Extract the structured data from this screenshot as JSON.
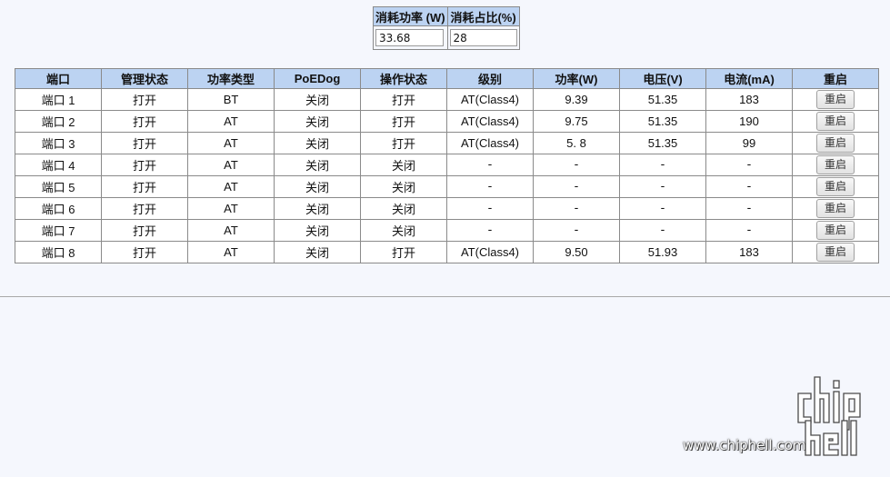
{
  "summary": {
    "headers": [
      "消耗功率 (W)",
      "消耗占比(%)"
    ],
    "values": [
      "33.68",
      "28"
    ]
  },
  "ports": {
    "headers": [
      "端口",
      "管理状态",
      "功率类型",
      "PoEDog",
      "操作状态",
      "级别",
      "功率(W)",
      "电压(V)",
      "电流(mA)",
      "重启"
    ],
    "rows": [
      {
        "port": "端口 1",
        "admin": "打开",
        "type": "BT",
        "poedog": "关闭",
        "oper": "打开",
        "class": "AT(Class4)",
        "power": "9.39",
        "voltage": "51.35",
        "current": "183",
        "restart": "重启"
      },
      {
        "port": "端口 2",
        "admin": "打开",
        "type": "AT",
        "poedog": "关闭",
        "oper": "打开",
        "class": "AT(Class4)",
        "power": "9.75",
        "voltage": "51.35",
        "current": "190",
        "restart": "重启"
      },
      {
        "port": "端口 3",
        "admin": "打开",
        "type": "AT",
        "poedog": "关闭",
        "oper": "打开",
        "class": "AT(Class4)",
        "power": "5. 8",
        "voltage": "51.35",
        "current": "99",
        "restart": "重启"
      },
      {
        "port": "端口 4",
        "admin": "打开",
        "type": "AT",
        "poedog": "关闭",
        "oper": "关闭",
        "class": "-",
        "power": "-",
        "voltage": "-",
        "current": "-",
        "restart": "重启"
      },
      {
        "port": "端口 5",
        "admin": "打开",
        "type": "AT",
        "poedog": "关闭",
        "oper": "关闭",
        "class": "-",
        "power": "-",
        "voltage": "-",
        "current": "-",
        "restart": "重启"
      },
      {
        "port": "端口 6",
        "admin": "打开",
        "type": "AT",
        "poedog": "关闭",
        "oper": "关闭",
        "class": "-",
        "power": "-",
        "voltage": "-",
        "current": "-",
        "restart": "重启"
      },
      {
        "port": "端口 7",
        "admin": "打开",
        "type": "AT",
        "poedog": "关闭",
        "oper": "关闭",
        "class": "-",
        "power": "-",
        "voltage": "-",
        "current": "-",
        "restart": "重启"
      },
      {
        "port": "端口 8",
        "admin": "打开",
        "type": "AT",
        "poedog": "关闭",
        "oper": "打开",
        "class": "AT(Class4)",
        "power": "9.50",
        "voltage": "51.93",
        "current": "183",
        "restart": "重启"
      }
    ]
  },
  "watermark": {
    "url": "www.chiphell.com",
    "logo_text": "chip hell"
  },
  "colors": {
    "header_bg": "#bcd3f2",
    "page_bg": "#f5f7fd",
    "border": "#8a8a8a"
  }
}
